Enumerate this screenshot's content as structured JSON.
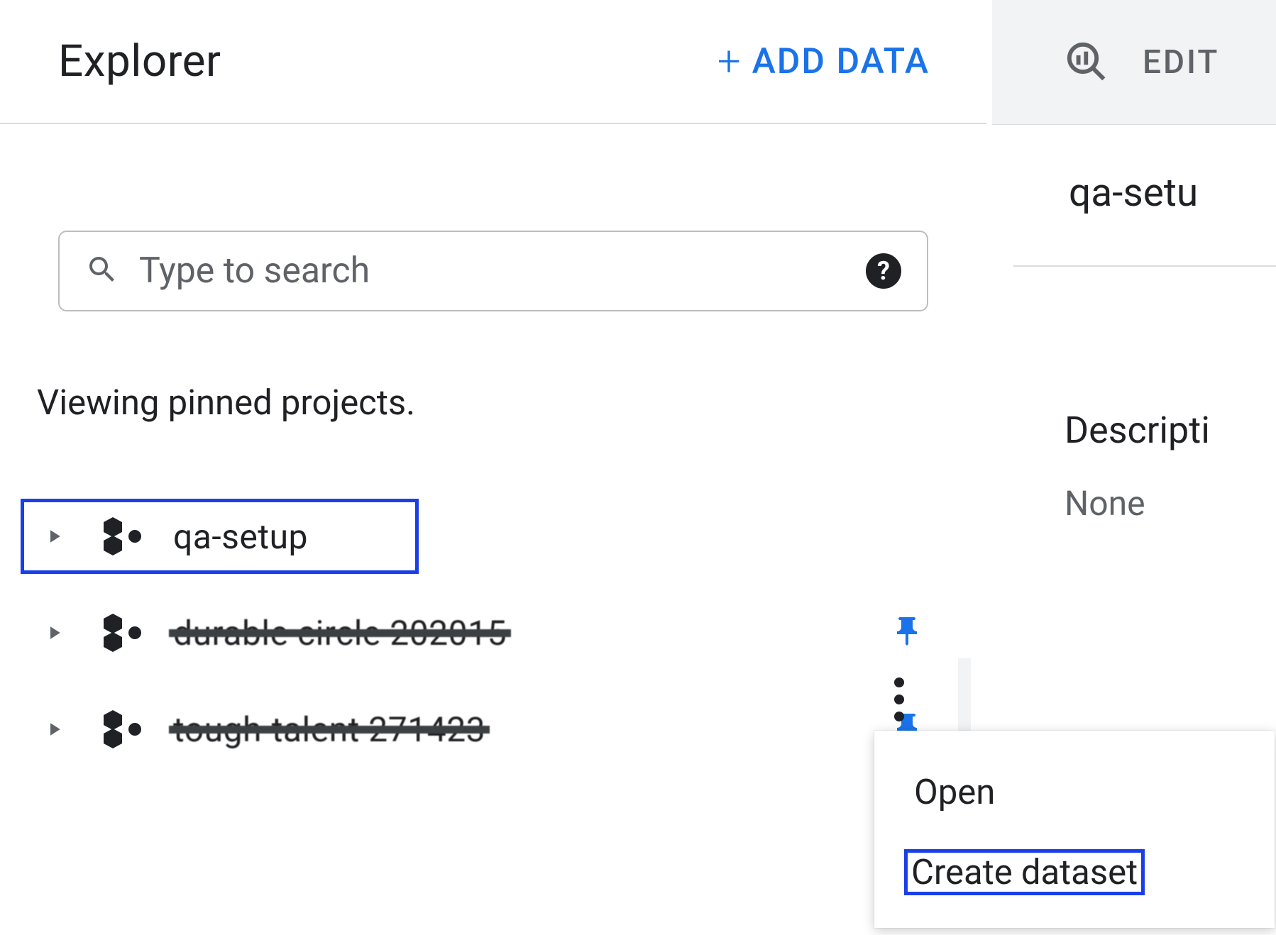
{
  "explorer": {
    "title": "Explorer",
    "add_data_label": "ADD DATA",
    "search_placeholder": "Type to search",
    "pinned_text": "Viewing pinned projects.",
    "projects": [
      {
        "name": "qa-setup",
        "pinned": false,
        "selected": true
      },
      {
        "name": "durable circle 202015",
        "pinned": true,
        "selected": false,
        "redacted": true
      },
      {
        "name": "tough-talent 271423",
        "pinned": true,
        "selected": false,
        "redacted": true
      }
    ]
  },
  "detail": {
    "toolbar_first": "EDIT",
    "title": "qa-setu",
    "description_label": "Descripti",
    "description_value": "None"
  },
  "context_menu": {
    "items": [
      {
        "label": "Open",
        "highlighted": false
      },
      {
        "label": "Create dataset",
        "highlighted": true
      }
    ]
  }
}
